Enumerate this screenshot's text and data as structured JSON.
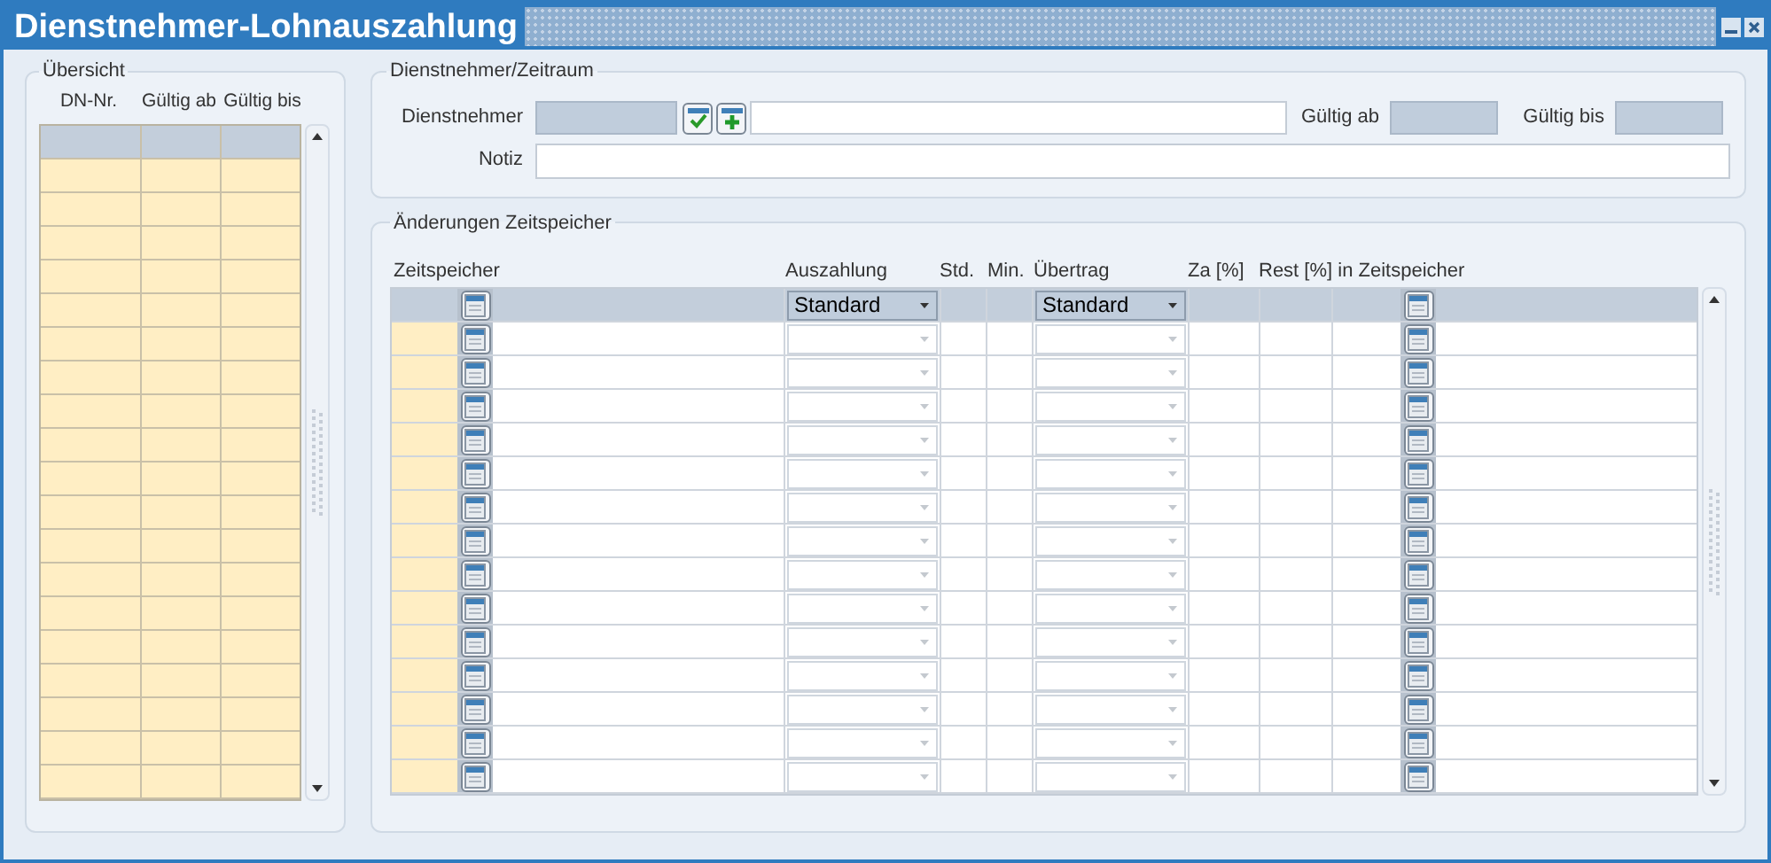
{
  "window": {
    "title": "Dienstnehmer-Lohnauszahlung"
  },
  "overview": {
    "title": "Übersicht",
    "columns": [
      "DN-Nr.",
      "Gültig ab",
      "Gültig bis"
    ],
    "rows": [
      {
        "selected": true
      },
      {
        "selected": false
      },
      {
        "selected": false
      },
      {
        "selected": false
      },
      {
        "selected": false
      },
      {
        "selected": false
      },
      {
        "selected": false
      },
      {
        "selected": false
      },
      {
        "selected": false
      },
      {
        "selected": false
      },
      {
        "selected": false
      },
      {
        "selected": false
      },
      {
        "selected": false
      },
      {
        "selected": false
      },
      {
        "selected": false
      },
      {
        "selected": false
      },
      {
        "selected": false
      },
      {
        "selected": false
      },
      {
        "selected": false
      },
      {
        "selected": false
      }
    ]
  },
  "employee": {
    "title": "Dienstnehmer/Zeitraum",
    "employee_label": "Dienstnehmer",
    "valid_from_label": "Gültig ab",
    "valid_to_label": "Gültig bis",
    "note_label": "Notiz"
  },
  "changes": {
    "title": "Änderungen Zeitspeicher",
    "columns": [
      "Zeitspeicher",
      "Auszahlung",
      "Std.",
      "Min.",
      "Übertrag",
      "Za [%]",
      "Rest [%] in Zeitspeicher"
    ],
    "rows": [
      {
        "selected": true,
        "auszahlung": "Standard",
        "uebertrag": "Standard"
      },
      {
        "selected": false
      },
      {
        "selected": false
      },
      {
        "selected": false
      },
      {
        "selected": false
      },
      {
        "selected": false
      },
      {
        "selected": false
      },
      {
        "selected": false
      },
      {
        "selected": false
      },
      {
        "selected": false
      },
      {
        "selected": false
      },
      {
        "selected": false
      },
      {
        "selected": false
      },
      {
        "selected": false
      },
      {
        "selected": false
      }
    ]
  }
}
